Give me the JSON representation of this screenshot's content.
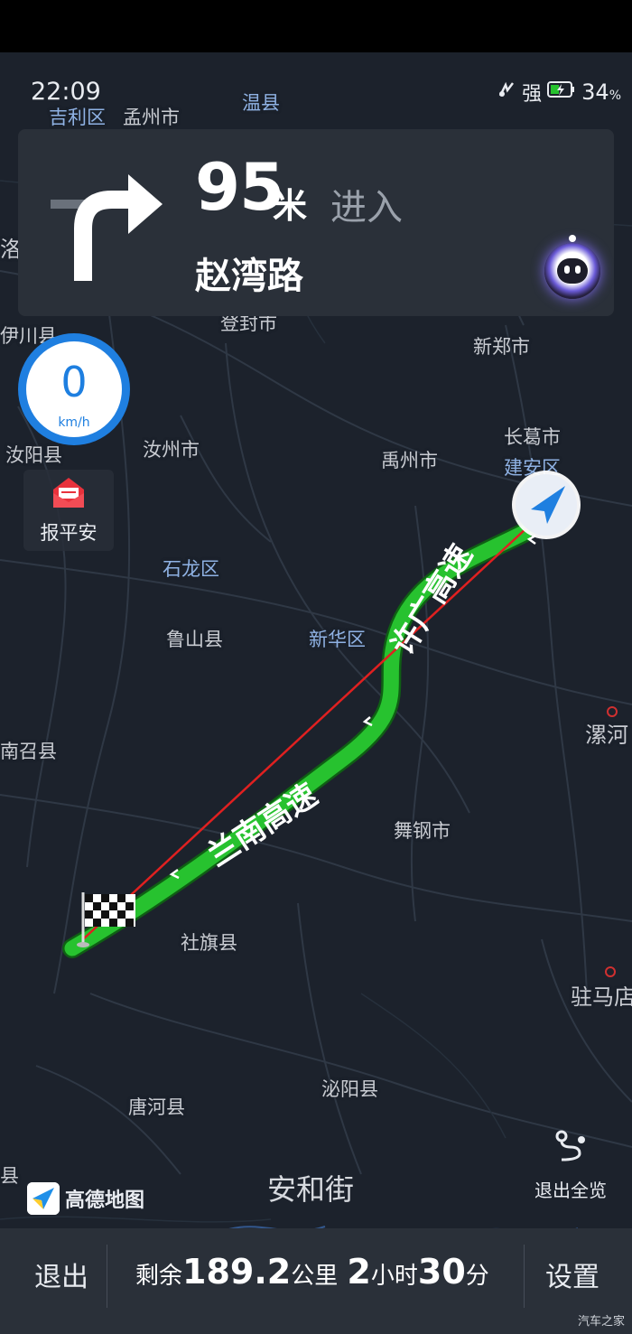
{
  "status_bar": {
    "time": "22:09",
    "signal_label": "强",
    "battery": "34"
  },
  "navigation": {
    "distance_value": "95",
    "distance_unit": "米",
    "action": "进入",
    "road_name": "赵湾路",
    "turn_direction": "right",
    "turn_icon": "turn-right-arrow-icon",
    "assistant_icon": "voice-assistant-icon"
  },
  "speed": {
    "value": "0",
    "unit": "km/h"
  },
  "safety": {
    "label": "报平安",
    "icon": "envelope-icon"
  },
  "map": {
    "cities": [
      {
        "name": "吉利区",
        "style": "blue"
      },
      {
        "name": "孟州市",
        "style": "normal"
      },
      {
        "name": "温县",
        "style": "blue"
      },
      {
        "name": "洛",
        "style": "normal"
      },
      {
        "name": "登封市",
        "style": "normal"
      },
      {
        "name": "伊川县",
        "style": "normal"
      },
      {
        "name": "新郑市",
        "style": "normal"
      },
      {
        "name": "长葛市",
        "style": "normal"
      },
      {
        "name": "建安区",
        "style": "blue"
      },
      {
        "name": "汝阳县",
        "style": "normal"
      },
      {
        "name": "汝州市",
        "style": "normal"
      },
      {
        "name": "禹州市",
        "style": "normal"
      },
      {
        "name": "石龙区",
        "style": "blue"
      },
      {
        "name": "鲁山县",
        "style": "normal"
      },
      {
        "name": "新华区",
        "style": "blue"
      },
      {
        "name": "漯河",
        "style": "large"
      },
      {
        "name": "南召县",
        "style": "normal"
      },
      {
        "name": "舞钢市",
        "style": "normal"
      },
      {
        "name": "社旗县",
        "style": "normal"
      },
      {
        "name": "驻马店",
        "style": "large"
      },
      {
        "name": "泌阳县",
        "style": "normal"
      },
      {
        "name": "唐河县",
        "style": "normal"
      },
      {
        "name": "县",
        "style": "normal"
      }
    ],
    "route_labels": [
      {
        "text": "兰南高速"
      },
      {
        "text": "许广高速"
      }
    ],
    "street_label": "安和街"
  },
  "brand": {
    "label": "高德地图",
    "icon": "amap-logo-icon"
  },
  "overview": {
    "label": "退出全览",
    "icon": "route-overview-icon"
  },
  "bottom_bar": {
    "exit_label": "退出",
    "remaining_label": "剩余",
    "remaining_distance": "189.2",
    "distance_unit": "公里",
    "hours": "2",
    "hours_unit": "小时",
    "minutes": "30",
    "minutes_unit": "分",
    "settings_label": "设置"
  },
  "watermark": "汽车之家",
  "colors": {
    "route": "#27c22f",
    "straight_line": "#e02020",
    "speed_ring": "#1f7fe0",
    "card_bg": "#2a3039",
    "map_bg": "#1c222c"
  }
}
